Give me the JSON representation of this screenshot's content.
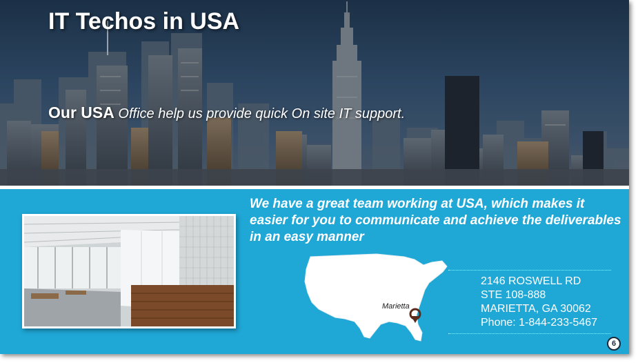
{
  "slide": {
    "title": "IT Techos in USA",
    "tagline": {
      "lead": "Our USA",
      "rest": "Office help us provide quick On site IT support."
    },
    "message": "We have a great team working at USA, which makes it easier for you to communicate and achieve the deliverables in an easy manner",
    "map": {
      "marker_label": "Marietta",
      "marker_color": "#5a2a1a"
    },
    "address": {
      "line1": "2146 ROSWELL RD",
      "line2": "STE 108-888",
      "line3": "MARIETTA, GA 30062",
      "phone": "Phone: 1-844-233-5467"
    },
    "page_number": "6"
  },
  "colors": {
    "accent": "#1fa7d6",
    "hero_dark": "#1b3046",
    "text": "#ffffff"
  },
  "icons": [
    "location-pin-icon"
  ]
}
